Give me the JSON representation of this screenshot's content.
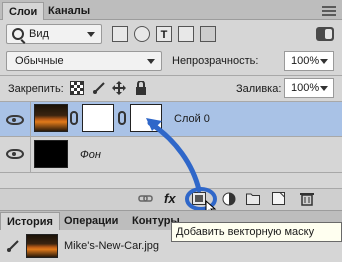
{
  "tabs": [
    {
      "label": "Слои",
      "active": true
    },
    {
      "label": "Каналы",
      "active": false
    }
  ],
  "filter": {
    "value": "Вид"
  },
  "blend_mode": {
    "value": "Обычные"
  },
  "opacity": {
    "label": "Непрозрачность:",
    "value": "100%"
  },
  "lock": {
    "label": "Закрепить:"
  },
  "fill": {
    "label": "Заливка:",
    "value": "100%"
  },
  "layers": [
    {
      "name": "Слой 0",
      "selected": true
    },
    {
      "name": "Фон",
      "selected": false
    }
  ],
  "bottom_toolbar": {
    "fx_label": "fx"
  },
  "bottom_tabs": [
    {
      "label": "История",
      "active": true
    },
    {
      "label": "Операции",
      "active": false
    },
    {
      "label": "Контуры",
      "active": false
    }
  ],
  "history": {
    "snapshot_name": "Mike's-New-Car.jpg"
  },
  "tooltip": {
    "text": "Добавить векторную маску"
  },
  "colors": {
    "selection": "#a9c2e6",
    "annotation_arrow": "#2f67c9",
    "panel_bg": "#d6d6d6"
  }
}
